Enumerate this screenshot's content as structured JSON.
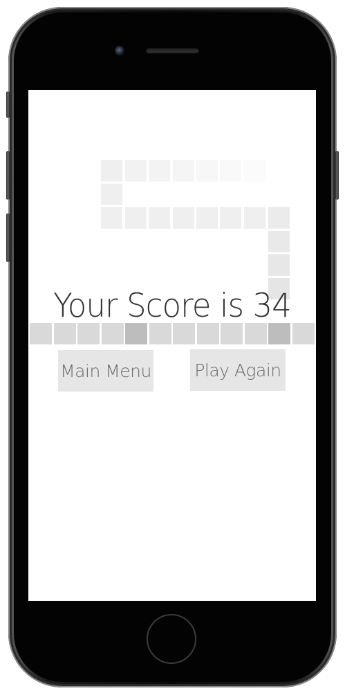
{
  "game": {
    "score_text": "Your Score is 34",
    "score": 34
  },
  "buttons": {
    "main_menu": "Main Menu",
    "play_again": "Play Again"
  },
  "colors": {
    "screen_background": "#ffffff",
    "score_text": "#333333",
    "button_background": "#e6e6e6",
    "button_text": "#6a6a6a",
    "row_cell": "#d9d9d9",
    "row_cell_highlight": "#bdbdbd",
    "snake_cell": "#f0f0f0"
  }
}
